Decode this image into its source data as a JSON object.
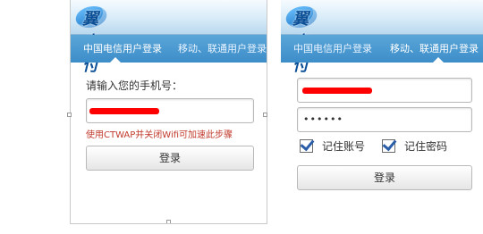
{
  "left_screen": {
    "logo_text": "翼支付",
    "tabs": [
      {
        "label": "中国电信用户登录",
        "active": true
      },
      {
        "label": "移动、联通用户登录",
        "active": false
      }
    ],
    "phone_prompt": "请输入您的手机号：",
    "hint": "使用CTWAP并关闭Wifi可加速此步骤",
    "login_button": "登录"
  },
  "right_screen": {
    "logo_text": "翼支付",
    "tabs": [
      {
        "label": "中国电信用户登录",
        "active": false
      },
      {
        "label": "移动、联通用户登录",
        "active": true
      }
    ],
    "password_mask": "••••••",
    "remember_account": {
      "label": "记住账号",
      "checked": true
    },
    "remember_password": {
      "label": "记住密码",
      "checked": true
    },
    "login_button": "登录"
  },
  "colors": {
    "tab_bar": "#3d8dc9",
    "hint": "#c0392b",
    "redaction": "#ff0000"
  }
}
